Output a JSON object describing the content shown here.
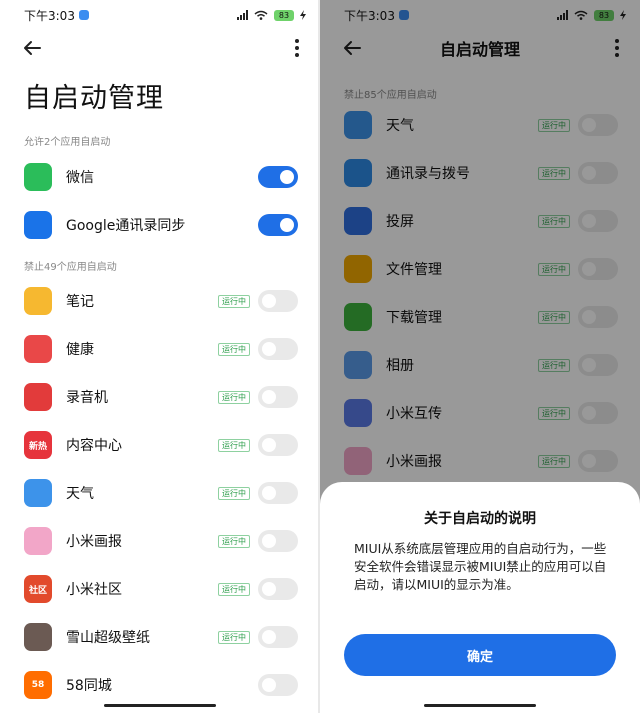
{
  "status": {
    "time": "下午3:03",
    "battery": "83"
  },
  "left": {
    "page_title": "自启动管理",
    "allow_section": "允许2个应用自启动",
    "allowed_apps": [
      {
        "label": "微信",
        "icon": "wechat-icon",
        "color": "#2bbd5a",
        "enabled": true
      },
      {
        "label": "Google通讯录同步",
        "icon": "contacts-sync-icon",
        "color": "#1a73e8",
        "enabled": true
      }
    ],
    "blocked_section": "禁止49个应用自启动",
    "blocked_apps": [
      {
        "label": "笔记",
        "icon": "notes-icon",
        "color": "#f6b830",
        "status": "运行中"
      },
      {
        "label": "健康",
        "icon": "health-icon",
        "color": "#e94848",
        "status": "运行中"
      },
      {
        "label": "录音机",
        "icon": "recorder-icon",
        "color": "#e23b3b",
        "status": "运行中"
      },
      {
        "label": "内容中心",
        "icon": "content-center-icon",
        "color": "#e6343c",
        "icon_text": "新热",
        "status": "运行中"
      },
      {
        "label": "天气",
        "icon": "weather-icon",
        "color": "#3d93ea",
        "status": "运行中"
      },
      {
        "label": "小米画报",
        "icon": "mi-wallpaper-icon",
        "color": "#f2a6c8",
        "status": "运行中"
      },
      {
        "label": "小米社区",
        "icon": "mi-community-icon",
        "color": "#e24a2c",
        "icon_text": "社区",
        "status": "运行中"
      },
      {
        "label": "雪山超级壁纸",
        "icon": "snow-mountain-wallpaper-icon",
        "color": "#6b5a53",
        "status": "运行中"
      },
      {
        "label": "58同城",
        "icon": "58-icon",
        "color": "#ff6d00",
        "icon_text": "58",
        "status": ""
      }
    ]
  },
  "right": {
    "title": "自启动管理",
    "blocked_section": "禁止85个应用自启动",
    "apps": [
      {
        "label": "天气",
        "icon": "weather-icon",
        "color": "#3d93ea",
        "status": "运行中"
      },
      {
        "label": "通讯录与拨号",
        "icon": "contacts-icon",
        "color": "#2e8be6",
        "status": "运行中"
      },
      {
        "label": "投屏",
        "icon": "screencast-icon",
        "color": "#2f6fe0",
        "status": "运行中"
      },
      {
        "label": "文件管理",
        "icon": "file-manager-icon",
        "color": "#f2a800",
        "status": "运行中"
      },
      {
        "label": "下载管理",
        "icon": "download-manager-icon",
        "color": "#3cb33c",
        "status": "运行中"
      },
      {
        "label": "相册",
        "icon": "gallery-icon",
        "color": "#5a9bea",
        "status": "运行中"
      },
      {
        "label": "小米互传",
        "icon": "mi-share-icon",
        "color": "#5b7ae6",
        "status": "运行中"
      },
      {
        "label": "小米画报",
        "icon": "mi-wallpaper-icon",
        "color": "#f2a6c8",
        "status": "运行中"
      }
    ],
    "dialog": {
      "title": "关于自启动的说明",
      "body": "MIUI从系统底层管理应用的自启动行为，一些安全软件会错误显示被MIUI禁止的应用可以自启动，请以MIUI的显示为准。",
      "confirm": "确定"
    }
  },
  "colors": {
    "accent": "#1f6fe6",
    "running": "#2e9e4c"
  }
}
